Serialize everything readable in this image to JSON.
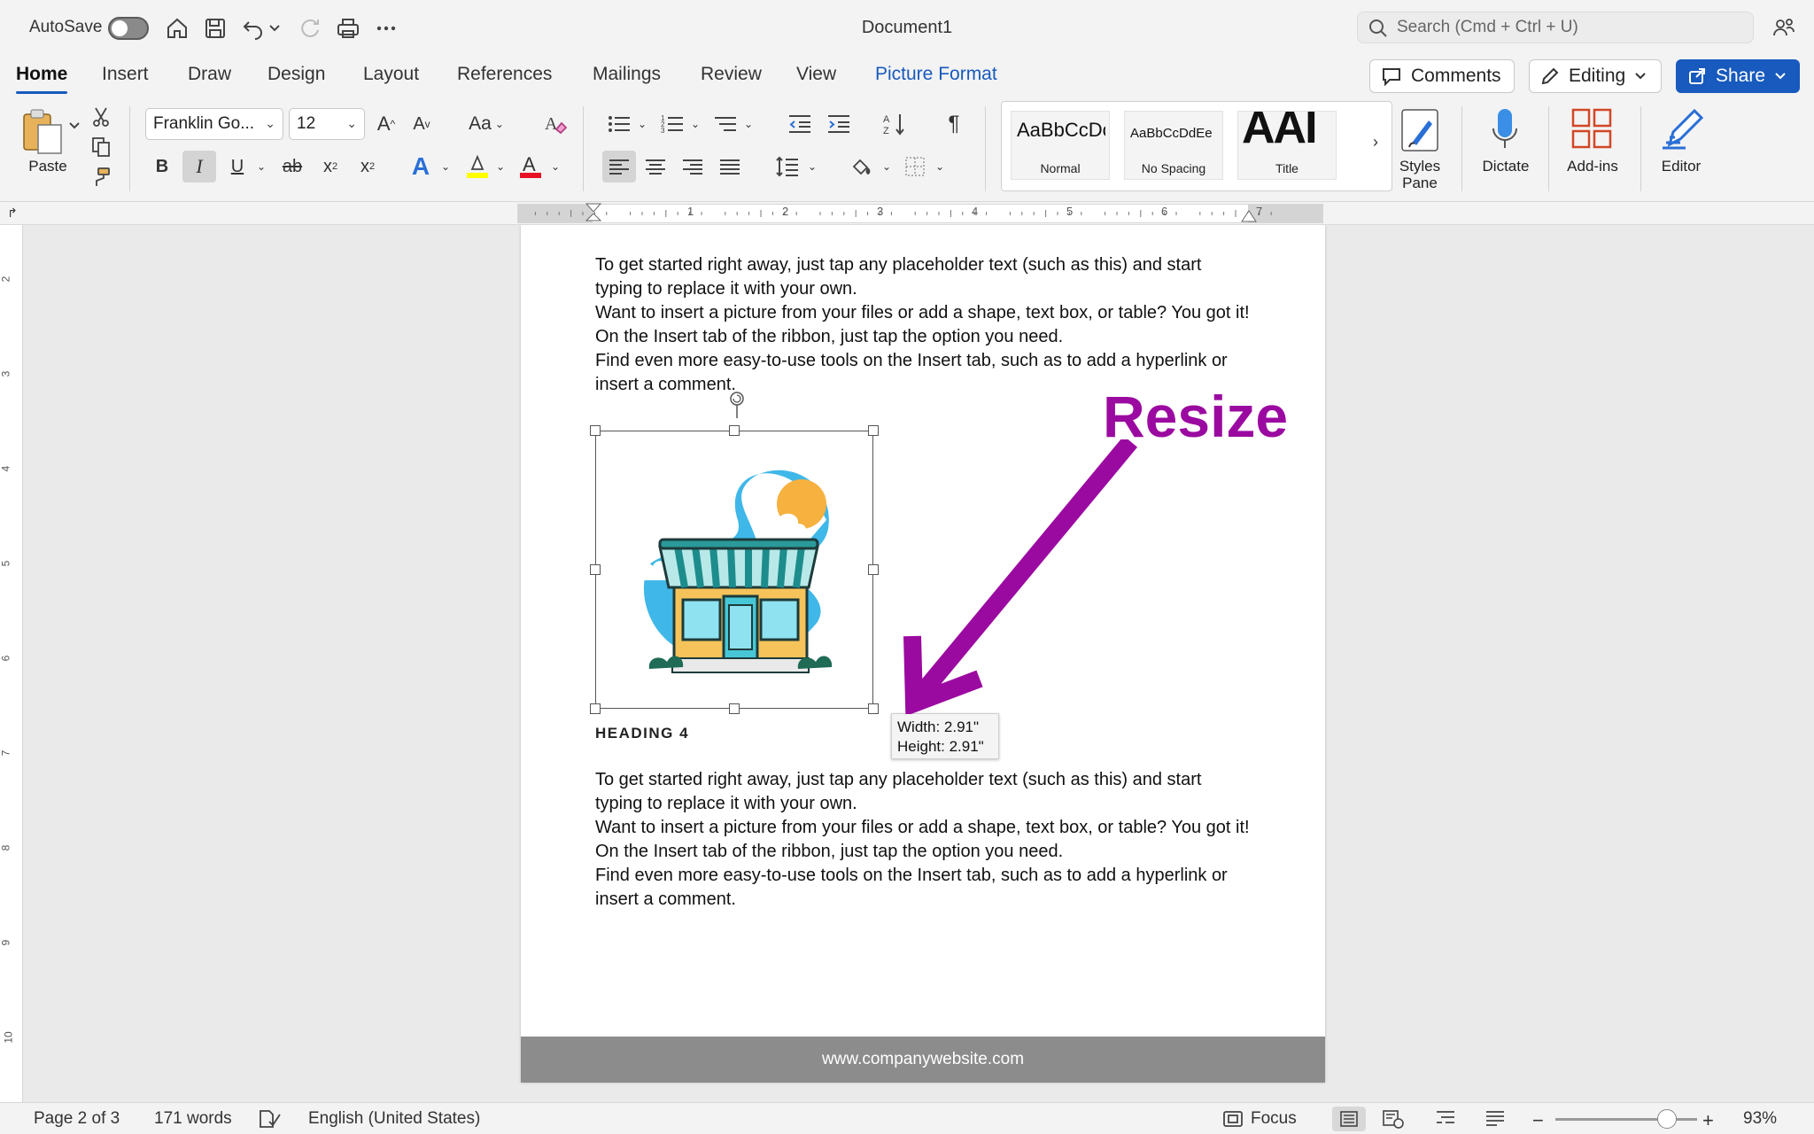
{
  "titlebar": {
    "autosave_label": "AutoSave",
    "doc_title": "Document1",
    "search_placeholder": "Search (Cmd + Ctrl + U)"
  },
  "tabs": [
    "Home",
    "Insert",
    "Draw",
    "Design",
    "Layout",
    "References",
    "Mailings",
    "Review",
    "View",
    "Picture Format"
  ],
  "header_buttons": {
    "comments": "Comments",
    "editing": "Editing",
    "share": "Share"
  },
  "ribbon": {
    "paste_label": "Paste",
    "font_name": "Franklin Go...",
    "font_size": "12",
    "styles": [
      {
        "sample": "AaBbCcDc",
        "name": "Normal"
      },
      {
        "sample": "AaBbCcDdEe",
        "name": "No Spacing"
      },
      {
        "sample": "AAI",
        "name": "Title"
      }
    ],
    "styles_pane_label": "Styles Pane",
    "dictate_label": "Dictate",
    "addins_label": "Add-ins",
    "editor_label": "Editor",
    "colors": {
      "highlight": "#ffff00",
      "font_color": "#e81123",
      "accent": "#185abd",
      "addins": "#d24726"
    }
  },
  "ruler": {
    "h_numbers": [
      "1",
      "2",
      "3",
      "4",
      "5",
      "6",
      "7"
    ],
    "v_numbers": [
      "2",
      "3",
      "4",
      "5",
      "6",
      "7",
      "8",
      "9",
      "10"
    ]
  },
  "document": {
    "para_top": [
      "To get started right away, just tap any placeholder text (such as this) and start typing to replace it with your own.",
      "Want to insert a picture from your files or add a shape, text box, or table? You got it! On the Insert tab of the ribbon, just tap the option you need.",
      "Find even more easy-to-use tools on the Insert tab, such as to add a hyperlink or insert a comment."
    ],
    "heading": "HEADING 4",
    "para_bottom": [
      "To get started right away, just tap any placeholder text (such as this) and start typing to replace it with your own.",
      "Want to insert a picture from your files or add a shape, text box, or table? You got it! On the Insert tab of the ribbon, just tap the option you need.",
      "Find even more easy-to-use tools on the Insert tab, such as to add a hyperlink or insert a comment."
    ],
    "footer": "www.companywebsite.com",
    "tooltip_width": "Width: 2.91\"",
    "tooltip_height": "Height: 2.91\"",
    "annotation": "Resize",
    "annotation_color": "#9b0aa0"
  },
  "statusbar": {
    "page": "Page 2 of 3",
    "words": "171 words",
    "language": "English (United States)",
    "focus": "Focus",
    "zoom_percent": "93%",
    "zoom_level": 0.93
  }
}
